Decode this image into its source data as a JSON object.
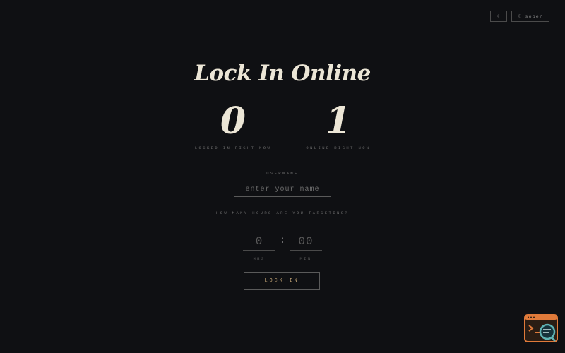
{
  "header": {
    "icon_button_label": "☾",
    "theme_button_label": "☾ sober"
  },
  "app": {
    "title": "Lock In Online"
  },
  "stats": [
    {
      "value": "0",
      "label": "LOCKED IN RIGHT NOW"
    },
    {
      "value": "1",
      "label": "ONLINE RIGHT NOW"
    }
  ],
  "form": {
    "username_label": "USERNAME",
    "username_placeholder": "enter your name",
    "question": "HOW MANY HOURS ARE YOU TARGETING?",
    "hours_placeholder": "0",
    "hours_unit": "HRS",
    "separator": ":",
    "minutes_placeholder": "00",
    "minutes_unit": "MIN",
    "submit_label": "LOCK IN"
  },
  "colors": {
    "background": "#0f1013",
    "title": "#ece6d6",
    "accent": "#bfa173",
    "widget": "#e07a3a",
    "widget_magnifier": "#5fb3b3"
  },
  "icons": {
    "floating_widget": "code-search-icon"
  }
}
